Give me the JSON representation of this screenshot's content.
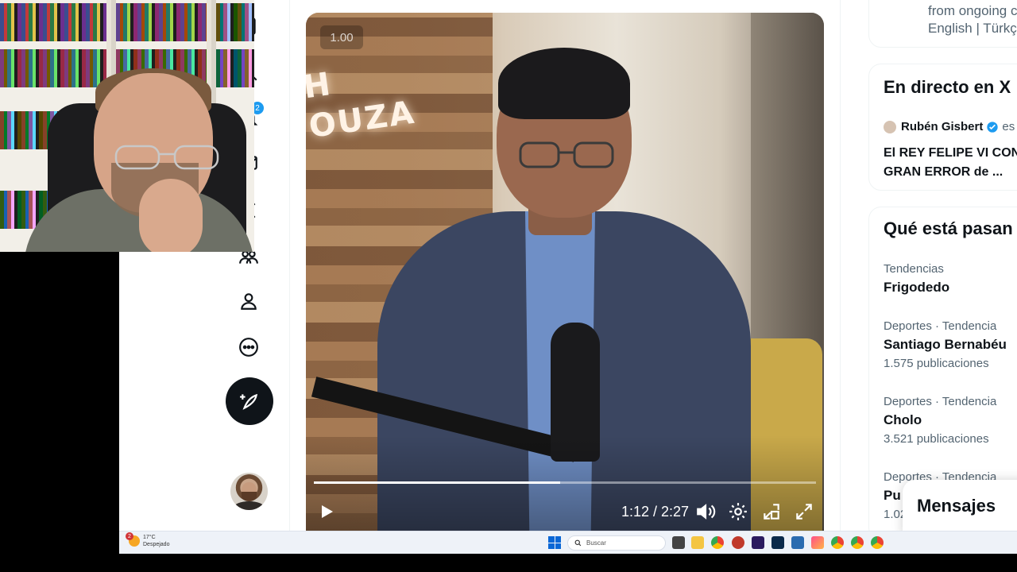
{
  "video": {
    "speed": "1.00",
    "time": "1:12 / 2:27",
    "progress_fraction": 0.49
  },
  "right": {
    "top_text_line1": "from ongoing c",
    "top_text_line2": "English | Türkç",
    "live_heading": "En directo en X",
    "live_user": "Rubén Gisbert",
    "live_user_suffix": "es",
    "live_title_line1": "El REY FELIPE VI CON",
    "live_title_line2": "GRAN ERROR de ...",
    "trends_heading": "Qué está pasan",
    "trends": [
      {
        "category": "Tendencias",
        "name": "Frigodedo",
        "count": ""
      },
      {
        "category": "Deportes · Tendencia",
        "name": "Santiago Bernabéu",
        "count": "1.575 publicaciones"
      },
      {
        "category": "Deportes · Tendencia",
        "name": "Cholo",
        "count": "3.521 publicaciones"
      },
      {
        "category": "Deportes · Tendencia",
        "name": "Pu",
        "count": "1.02"
      }
    ]
  },
  "messages": {
    "label": "Mensajes"
  },
  "taskbar": {
    "weather_badge": "2",
    "weather_temp": "17°C",
    "weather_cond": "Despejado",
    "search_placeholder": "Buscar"
  },
  "nav": {
    "notification_count": "2"
  },
  "colors": {
    "accent": "#1d9bf0",
    "text": "#0f1419",
    "muted": "#536471"
  }
}
